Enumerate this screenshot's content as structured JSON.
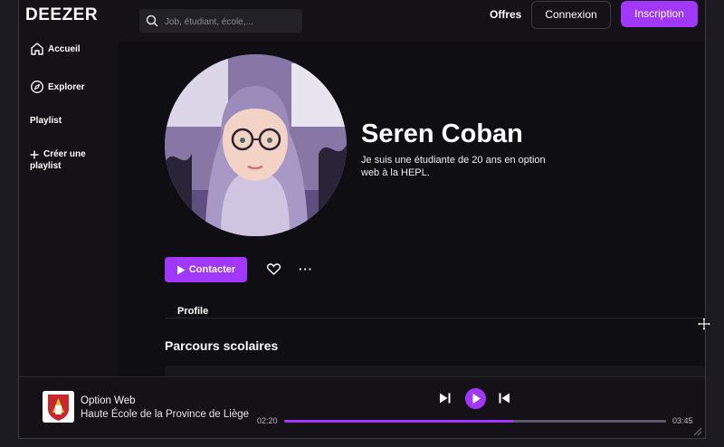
{
  "header": {
    "logo": "DEEZER",
    "search_placeholder": "Job, étudiant, école,...",
    "offers": "Offres",
    "login": "Connexion",
    "signup": "Inscription"
  },
  "sidebar": {
    "items": [
      {
        "label": "Accueil",
        "icon": "home-icon"
      },
      {
        "label": "Explorer",
        "icon": "compass-icon"
      },
      {
        "label": "Playlist"
      },
      {
        "label_line1": "Créer une",
        "label_line2": "playlist",
        "icon": "plus-icon"
      }
    ]
  },
  "profile": {
    "name": "Seren Coban",
    "bio": "Je suis une étudiante de 20 ans en option web à la HEPL.",
    "contact": "Contacter"
  },
  "tabs": {
    "profile": "Profile"
  },
  "sections": {
    "education_title": "Parcours scolaires"
  },
  "player": {
    "title": "Option Web",
    "subtitle": "Haute École de la Province de Liège",
    "current_time": "02:20",
    "total_time": "03:45",
    "progress": 0.6
  },
  "colors": {
    "accent": "#a238ff",
    "background": "#141216"
  }
}
